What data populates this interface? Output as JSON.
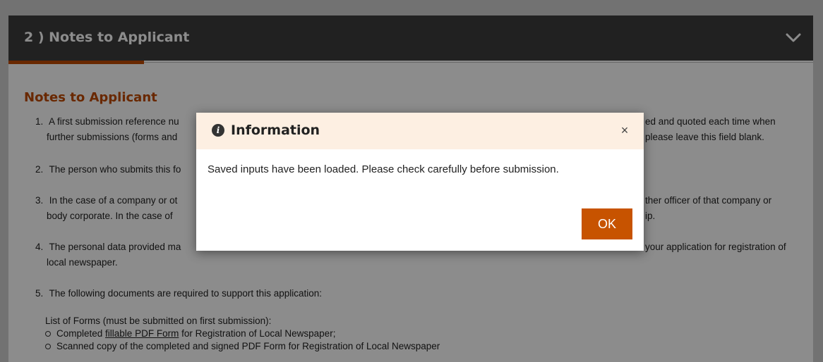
{
  "panel": {
    "title": "2 ) Notes to Applicant"
  },
  "notes": {
    "heading": "Notes to Applicant",
    "items": [
      {
        "num": "1.",
        "line1": "A first submission reference nu",
        "line1_right": "ed and quoted each time when",
        "line2": "further submissions (forms and",
        "line2_right": "please leave this field blank."
      },
      {
        "num": "2.",
        "line1": "The person who submits this fo"
      },
      {
        "num": "3.",
        "line1": "In the case of a company or ot",
        "line1_right": "ther officer of that company or",
        "line2": "body corporate. In the case of",
        "line2_right": "ip."
      },
      {
        "num": "4.",
        "line1": "The personal data provided ma",
        "line1_right": "your application for registration of",
        "line2": "local newspaper."
      },
      {
        "num": "5.",
        "line1": "The following documents are required to support this application:"
      }
    ],
    "list_heading": "List of Forms (must be submitted on first submission):",
    "bullets": [
      {
        "prefix": "Completed ",
        "link": "fillable PDF Form",
        "suffix": " for Registration of Local Newspaper;"
      },
      {
        "text": "Scanned copy of the completed and signed PDF Form for Registration of Local Newspaper"
      }
    ]
  },
  "modal": {
    "icon": "info-icon",
    "title": "Information",
    "close_label": "×",
    "message": "Saved inputs have been loaded. Please check carefully before submission.",
    "ok_label": "OK"
  },
  "colors": {
    "accent": "#c04a00",
    "button": "#c75300",
    "header_bg": "#3c3c3c",
    "modal_header_bg": "#fdefe2"
  }
}
